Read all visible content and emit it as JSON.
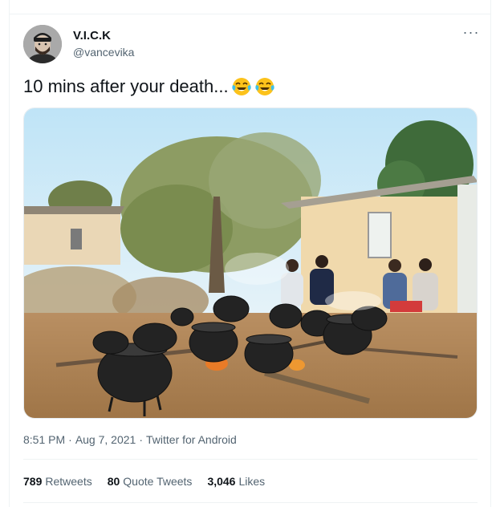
{
  "user": {
    "display_name": "V.I.C.K",
    "handle": "@vancevika",
    "avatar_icon": "avatar-photo"
  },
  "more_icon": "more-options-icon",
  "more_label": "···",
  "tweet": {
    "text": "10 mins after your death...",
    "emojis": [
      "face-with-tears-of-joy-icon",
      "face-with-tears-of-joy-icon"
    ]
  },
  "media": {
    "type": "photo"
  },
  "meta": {
    "time": "8:51 PM",
    "sep1": "·",
    "date": "Aug 7, 2021",
    "sep2": "·",
    "source": "Twitter for Android"
  },
  "stats": {
    "retweets_count": "789",
    "retweets_label": "Retweets",
    "quotes_count": "80",
    "quotes_label": "Quote Tweets",
    "likes_count": "3,046",
    "likes_label": "Likes"
  },
  "colors": {
    "text_primary": "#0f1419",
    "text_secondary": "#536471",
    "divider": "#eff3f4"
  }
}
